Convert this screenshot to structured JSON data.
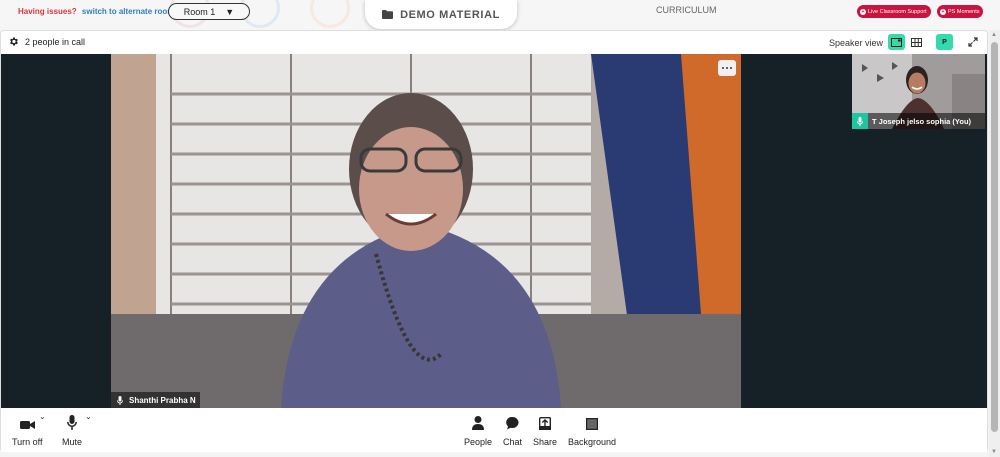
{
  "topbar": {
    "issues_label": "Having issues?",
    "alternate_room_link": "switch to alternate room",
    "room_select_value": "Room 1",
    "demo_material_label": "DEMO MATERIAL",
    "curriculum_label": "CURRICULUM",
    "live_support_label": "Live Classroom Support",
    "ps_moments_label": "PS Moments"
  },
  "call": {
    "people_count": "2 people in call",
    "view_label": "Speaker view",
    "participant_badge": "P"
  },
  "main_video": {
    "name": "Shanthi Prabha N"
  },
  "self_video": {
    "name": "T Joseph jelso sophia (You)"
  },
  "toolbar": {
    "camera_label": "Turn off",
    "mic_label": "Mute",
    "people_label": "People",
    "chat_label": "Chat",
    "share_label": "Share",
    "background_label": "Background"
  },
  "colors": {
    "accent": "#34d9ad",
    "alert": "#c8143e",
    "link": "#2f7fc1",
    "issues": "#d93636",
    "stage": "#162027"
  },
  "icons": [
    "folder-icon",
    "gear-icon",
    "speaker-view-icon",
    "grid-view-icon",
    "fullscreen-icon",
    "more-icon",
    "mic-icon",
    "camera-icon",
    "person-icon",
    "chat-icon",
    "share-icon",
    "background-icon",
    "chevron-down-icon"
  ]
}
